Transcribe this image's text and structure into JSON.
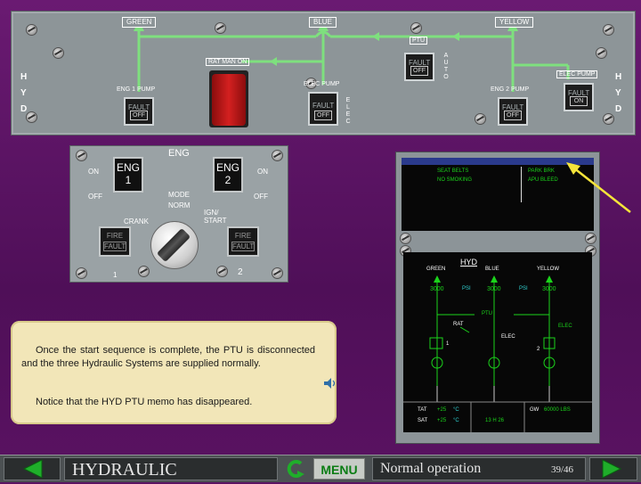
{
  "hyd_panel": {
    "systems": [
      "GREEN",
      "BLUE",
      "YELLOW"
    ],
    "side_letters": [
      "H",
      "Y",
      "D"
    ],
    "ptu_label": "PTU",
    "ptu_side": [
      "A",
      "U",
      "T",
      "O"
    ],
    "rat_label": "RAT MAN ON",
    "elec_label": [
      "E",
      "L",
      "E",
      "C"
    ],
    "pumps": [
      {
        "label": "ENG 1 PUMP",
        "fault": "FAULT",
        "state": "OFF"
      },
      {
        "label": "ELEC PUMP",
        "fault": "FAULT",
        "state": "OFF"
      },
      {
        "label": "PTU",
        "fault": "FAULT",
        "state": "OFF"
      },
      {
        "label": "ENG 2 PUMP",
        "fault": "FAULT",
        "state": "OFF"
      },
      {
        "label": "ELEC PUMP",
        "fault": "FAULT",
        "state": "ON"
      }
    ]
  },
  "eng_panel": {
    "title": "ENG",
    "eng1": [
      "ENG",
      "1"
    ],
    "eng2": [
      "ENG",
      "2"
    ],
    "on": "ON",
    "off": "OFF",
    "mode": "MODE",
    "norm": "NORM",
    "crank": "CRANK",
    "ign_start": "IGN/\nSTART",
    "fire": "FIRE",
    "fault": "FAULT",
    "num1": "1",
    "num2": "2"
  },
  "ecam_upper": {
    "memo_left": [
      "SEAT BELTS",
      "NO SMOKING"
    ],
    "memo_right": [
      "PARK BRK",
      "APU BLEED"
    ]
  },
  "ecam_lower": {
    "title": "HYD",
    "systems": [
      "GREEN",
      "BLUE",
      "YELLOW"
    ],
    "pressures": [
      "3000",
      "3000",
      "3000"
    ],
    "psi": "PSI",
    "ptu": "PTU",
    "rat": "RAT",
    "elec": "ELEC",
    "elec_right": "ELEC",
    "one": "1",
    "two": "2",
    "tat_label": "TAT",
    "tat_value": "+25",
    "sat_label": "SAT",
    "sat_value": "+25",
    "unit": "°C",
    "time": "13 H 26",
    "gw_label": "GW",
    "gw_value": "60000 LBS"
  },
  "text_box": {
    "para1": "Once the start sequence is complete, the PTU is disconnected and the three Hydraulic Systems are supplied normally.",
    "para2": "Notice that the HYD PTU memo has disappeared."
  },
  "bottom_bar": {
    "section": "HYDRAULIC",
    "menu": "MENU",
    "mode": "Normal operation",
    "page": "39/46"
  },
  "colors": {
    "background": "#5a1262",
    "hyd_line": "#7ee07e",
    "ecam_green": "#1bd31b",
    "ecam_cyan": "#2fd0d0",
    "pointer_arrow": "#f5e43a",
    "rat_red": "#c41a1a"
  }
}
